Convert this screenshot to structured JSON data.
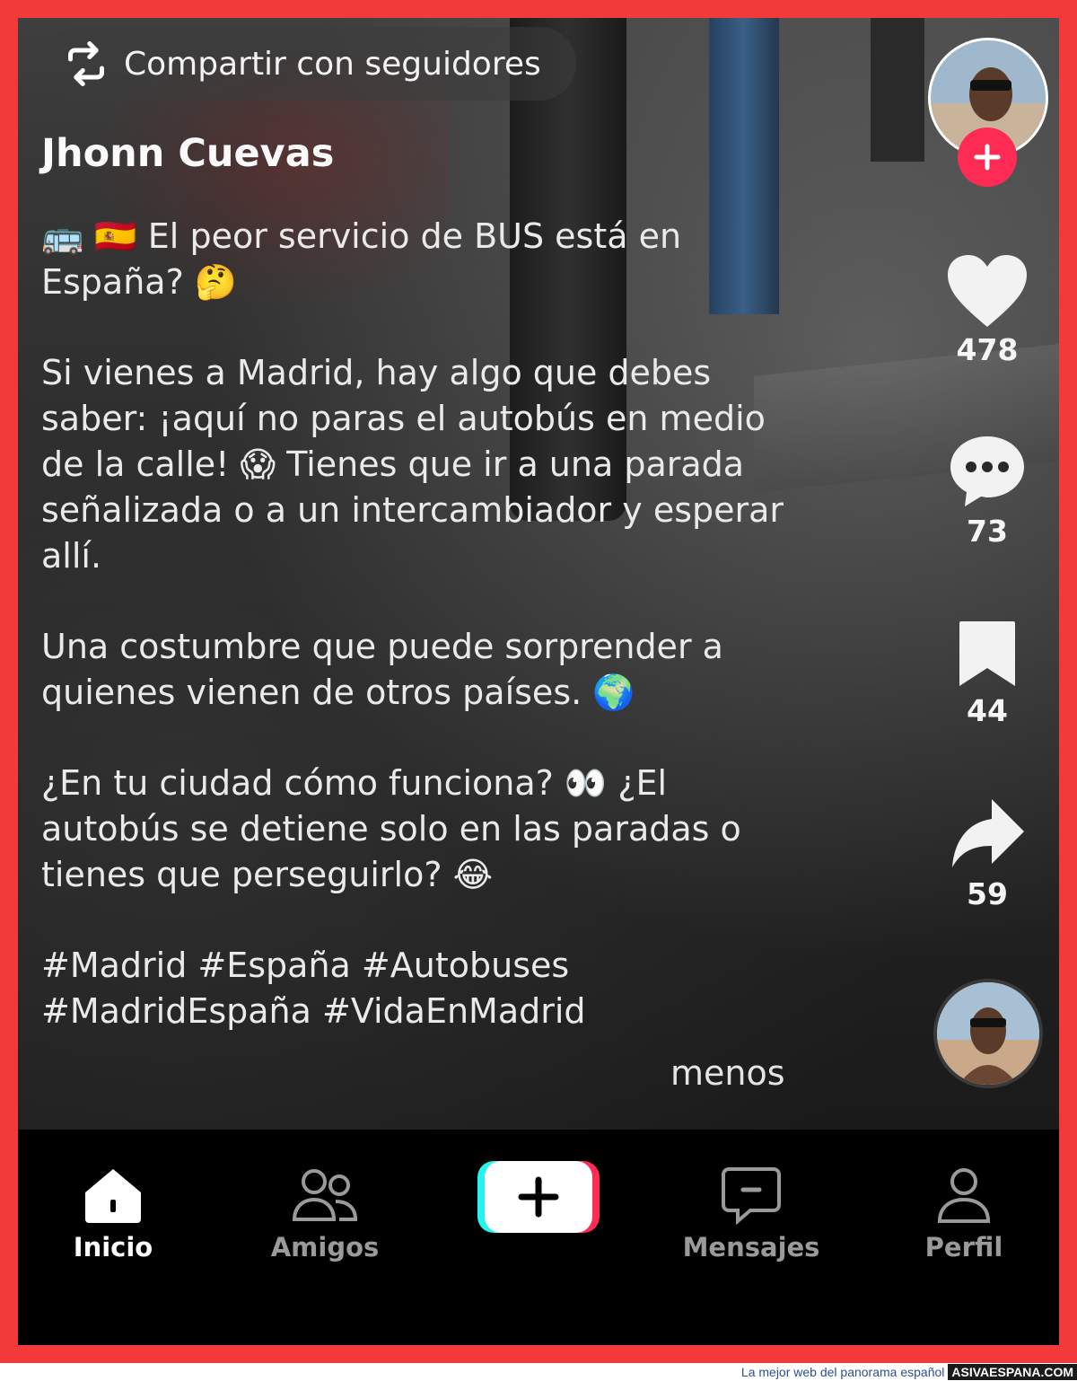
{
  "share": {
    "label": "Compartir con seguidores",
    "icon": "repost-icon"
  },
  "author": {
    "name": "Jhonn Cuevas"
  },
  "caption": {
    "line1_emoji": "🚌 🇪🇸",
    "line1_text": " El peor servicio de BUS está en España? ",
    "line1_end_emoji": "🤔",
    "p2_a": "Si vienes a Madrid, hay algo que debes saber: ¡aquí no paras el autobús en medio de la calle! ",
    "p2_emoji": "😱",
    "p2_b": " Tienes que ir a una parada señalizada o a un intercambiador y esperar allí.",
    "p3_text": "Una costumbre que puede sorprender a quienes vienen de otros países. ",
    "p3_emoji": "🌍",
    "p4_a": "¿En tu ciudad cómo funciona? ",
    "p4_emoji": "👀",
    "p4_b": " ¿El autobús se detiene solo en las paradas o tienes que perseguirlo? ",
    "p4_end_emoji": "😂",
    "hashtags_line1": "#Madrid #España #Autobuses",
    "hashtags_line2": "#MadridEspaña #VidaEnMadrid"
  },
  "more_label": "menos",
  "rail": {
    "likes": "478",
    "comments": "73",
    "saves": "44",
    "shares": "59"
  },
  "nav": {
    "home": "Inicio",
    "friends": "Amigos",
    "messages": "Mensajes",
    "profile": "Perfil"
  },
  "footer": {
    "slogan": "La mejor web del panorama español",
    "site": "ASIVAESPANA.COM"
  },
  "colors": {
    "frame": "#f23a3a",
    "follow": "#fe2c55",
    "accent_cyan": "#25f4ee"
  }
}
